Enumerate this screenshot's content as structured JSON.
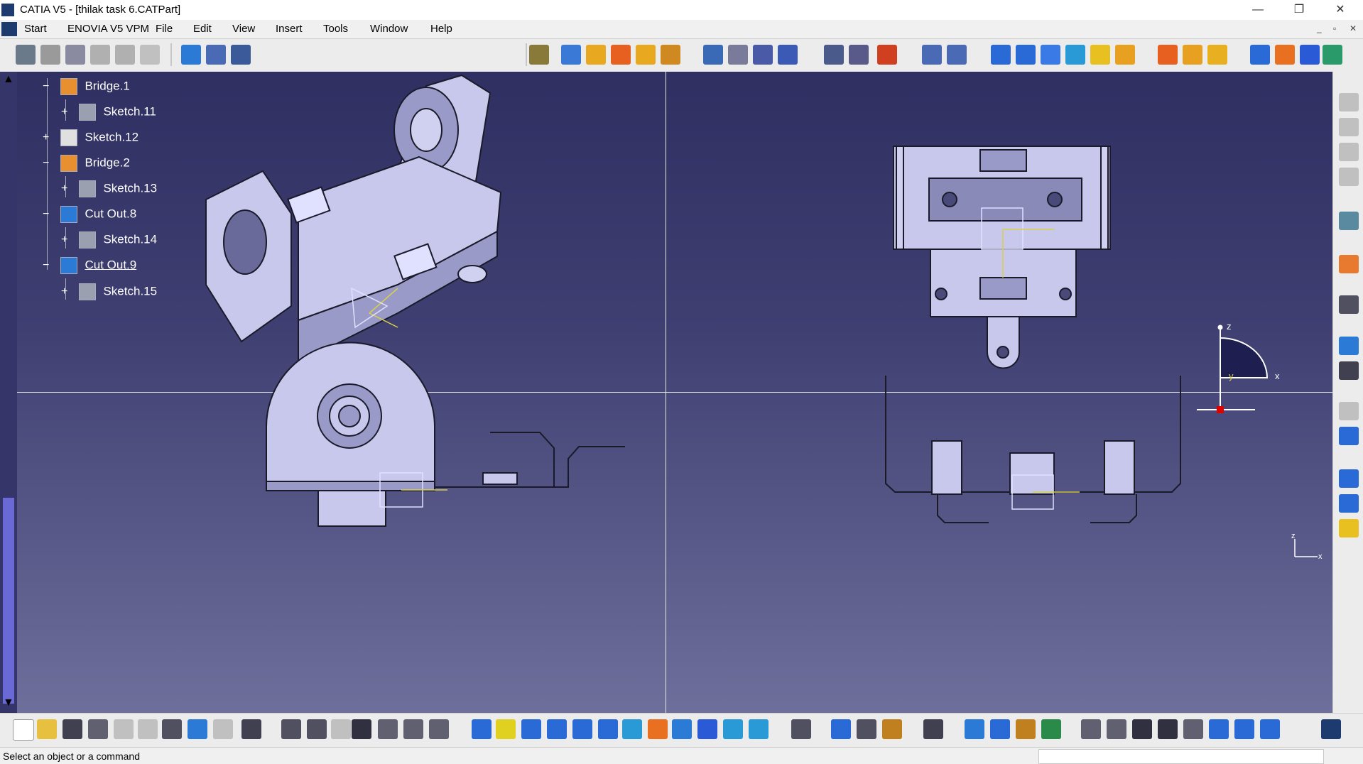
{
  "window": {
    "title": "CATIA V5 - [thilak task 6.CATPart]",
    "controls": [
      "—",
      "❐",
      "✕"
    ],
    "mdi_controls": [
      "_",
      "▫",
      "✕"
    ]
  },
  "menu": {
    "start": "Start",
    "enovia": "ENOVIA V5 VPM",
    "file": "File",
    "edit": "Edit",
    "view": "View",
    "insert": "Insert",
    "tools": "Tools",
    "window": "Window",
    "help": "Help"
  },
  "tree": {
    "items": [
      {
        "label": "Bridge.1",
        "icon": "bridge-icon"
      },
      {
        "label": "Sketch.11",
        "icon": "sketch-icon"
      },
      {
        "label": "Sketch.12",
        "icon": "sketch-icon"
      },
      {
        "label": "Bridge.2",
        "icon": "bridge-icon"
      },
      {
        "label": "Sketch.13",
        "icon": "sketch-icon"
      },
      {
        "label": "Cut Out.8",
        "icon": "cutout-icon"
      },
      {
        "label": "Sketch.14",
        "icon": "sketch-icon"
      },
      {
        "label": "Cut Out.9",
        "icon": "cutout-icon"
      },
      {
        "label": "Sketch.15",
        "icon": "sketch-icon"
      }
    ]
  },
  "compass": {
    "z": "z",
    "x": "x",
    "y": "y"
  },
  "axis_small": {
    "z": "z",
    "x": "x"
  },
  "colors": {
    "viewport_top": "#2f2f62",
    "viewport_bottom": "#6f6f9c",
    "part_fill": "#c8c8ec",
    "part_stroke": "#1a1a2a",
    "sketch_yellow": "#d8d04a"
  },
  "status": {
    "message": "Select an object or a command"
  }
}
